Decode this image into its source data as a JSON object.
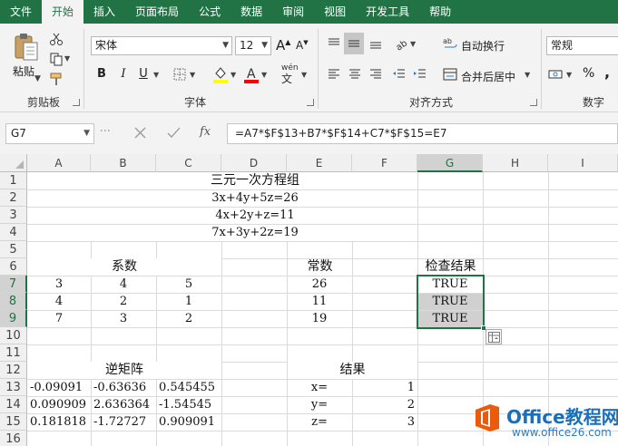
{
  "ribbon": {
    "tabs": [
      {
        "label": "文件",
        "active": false
      },
      {
        "label": "开始",
        "active": true
      },
      {
        "label": "插入",
        "active": false
      },
      {
        "label": "页面布局",
        "active": false
      },
      {
        "label": "公式",
        "active": false
      },
      {
        "label": "数据",
        "active": false
      },
      {
        "label": "审阅",
        "active": false
      },
      {
        "label": "视图",
        "active": false
      },
      {
        "label": "开发工具",
        "active": false
      },
      {
        "label": "帮助",
        "active": false
      }
    ],
    "clipboard": {
      "paste_label": "粘贴",
      "group_label": "剪贴板"
    },
    "font": {
      "family": "宋体",
      "size": "12",
      "bold": "B",
      "italic": "I",
      "underline": "U",
      "grow": "A",
      "shrink": "A",
      "phonetic": "wén",
      "group_label": "字体",
      "fill_color": "#ffff00",
      "font_color": "#ff0000"
    },
    "alignment": {
      "wrap_label": "自动换行",
      "merge_label": "合并后居中",
      "group_label": "对齐方式"
    },
    "number": {
      "format": "常规",
      "percent": "%",
      "comma": ",",
      "group_label": "数字"
    }
  },
  "formula_bar": {
    "name_box": "G7",
    "formula": "=A7*$F$13+B7*$F$14+C7*$F$15=E7",
    "fx": "fx"
  },
  "sheet": {
    "columns": [
      "A",
      "B",
      "C",
      "D",
      "E",
      "F",
      "G",
      "H",
      "I"
    ],
    "selected_column": "G",
    "rows": [
      "1",
      "2",
      "3",
      "4",
      "5",
      "6",
      "7",
      "8",
      "9",
      "10",
      "11",
      "12",
      "13",
      "14",
      "15",
      "16"
    ],
    "selected_rows": [
      "7",
      "8",
      "9"
    ],
    "cells": {
      "title": "三元一次方程组",
      "eq1": "3x+4y+5z=26",
      "eq2": "4x+2y+z=11",
      "eq3": "7x+3y+2z=19",
      "coef_header": "系数",
      "const_header": "常数",
      "check_header": "检查结果",
      "a7": "3",
      "b7": "4",
      "c7": "5",
      "e7": "26",
      "g7": "TRUE",
      "a8": "4",
      "b8": "2",
      "c8": "1",
      "e8": "11",
      "g8": "TRUE",
      "a9": "7",
      "b9": "3",
      "c9": "2",
      "e9": "19",
      "g9": "TRUE",
      "inv_header": "逆矩阵",
      "result_header": "结果",
      "a13": "-0.09091",
      "b13": "-0.63636",
      "c13": "0.545455",
      "e13": "x=",
      "f13": "1",
      "a14": "0.090909",
      "b14": "2.636364",
      "c14": "-1.54545",
      "e14": "y=",
      "f14": "2",
      "a15": "0.181818",
      "b15": "-1.72727",
      "c15": "0.909091",
      "e15": "z=",
      "f15": "3"
    }
  },
  "watermark": {
    "title": "Office教程网",
    "url": "www.office26.com"
  },
  "colors": {
    "accent": "#217346",
    "shade": "#d0d0d0",
    "watermark_blue": "#1b6fb7",
    "watermark_orange": "#ea5b0c"
  }
}
